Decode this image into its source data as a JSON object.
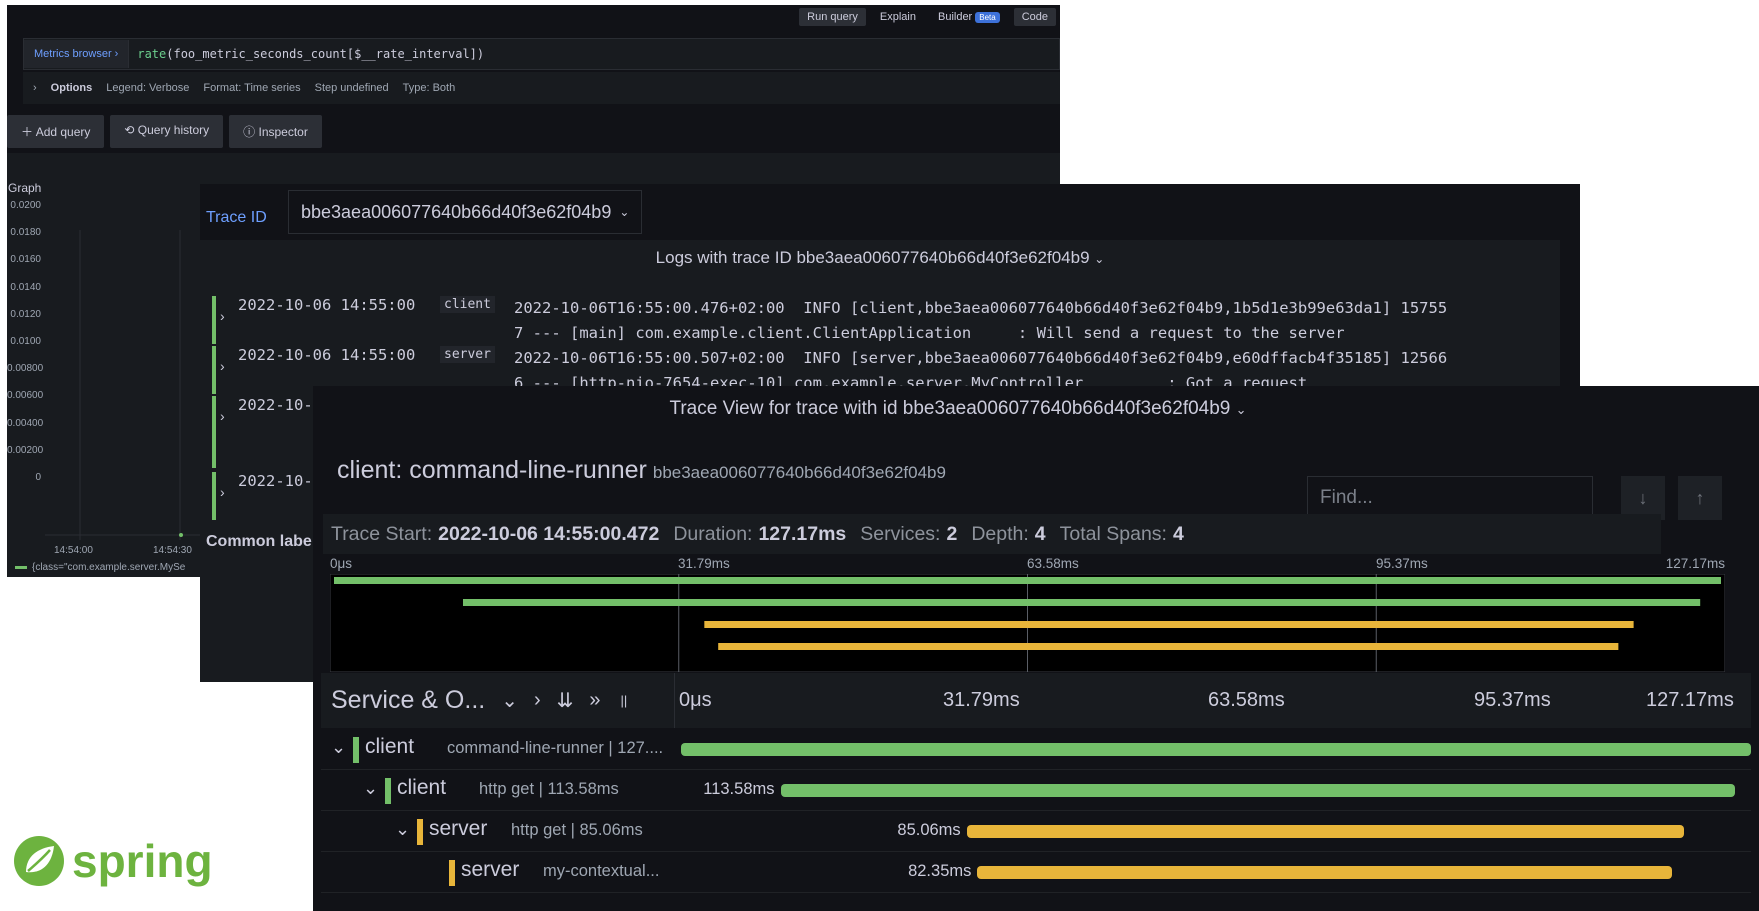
{
  "explore": {
    "toolbar": {
      "run_query": "Run query",
      "explain": "Explain",
      "builder": "Builder",
      "beta": "Beta",
      "code": "Code"
    },
    "query": {
      "metrics_browser": "Metrics browser ›",
      "fn": "rate",
      "expr": "(foo_metric_seconds_count[$__rate_interval])"
    },
    "options": {
      "label": "Options",
      "legend": "Legend: Verbose",
      "format": "Format: Time series",
      "step": "Step undefined",
      "type": "Type: Both"
    },
    "actions": {
      "add_query": "Add query",
      "query_history": "Query history",
      "inspector": "Inspector"
    },
    "graph": {
      "title": "Graph",
      "yticks": [
        "0.0200",
        "0.0180",
        "0.0160",
        "0.0140",
        "0.0120",
        "0.0100",
        "0.00800",
        "0.00600",
        "0.00400",
        "0.00200",
        "0"
      ],
      "xticks": [
        "14:54:00",
        "14:54:30"
      ],
      "legend": "{class=\"com.example.server.MySe"
    }
  },
  "logs": {
    "trace_id_label": "Trace ID",
    "trace_id": "bbe3aea006077640b66d40f3e62f04b9",
    "title": "Logs with trace ID bbe3aea006077640b66d40f3e62f04b9",
    "rows": [
      {
        "ts": "2022-10-06 14:55:00",
        "svc": "client",
        "msg": "2022-10-06T16:55:00.476+02:00  INFO [client,bbe3aea006077640b66d40f3e62f04b9,1b5d1e3b99e63da1] 15755\n7 --- [main] com.example.client.ClientApplication     : Will send a request to the server"
      },
      {
        "ts": "2022-10-06 14:55:00",
        "svc": "server",
        "msg": "2022-10-06T16:55:00.507+02:00  INFO [server,bbe3aea006077640b66d40f3e62f04b9,e60dffacb4f35185] 12566\n6 --- [http-nio-7654-exec-10] com.example.server.MyController         : Got a request"
      },
      {
        "ts": "2022-10-",
        "svc": "",
        "msg": ""
      },
      {
        "ts": "2022-10-",
        "svc": "",
        "msg": ""
      }
    ],
    "common_labels": "Common labe"
  },
  "trace": {
    "title": "Trace View for trace with id bbe3aea006077640b66d40f3e62f04b9",
    "name": "client: command-line-runner",
    "trace_id": "bbe3aea006077640b66d40f3e62f04b9",
    "find_placeholder": "Find...",
    "summary": {
      "trace_start_label": "Trace Start:",
      "trace_start": "2022-10-06 14:55:00.472",
      "duration_label": "Duration:",
      "duration": "127.17ms",
      "services_label": "Services:",
      "services": "2",
      "depth_label": "Depth:",
      "depth": "4",
      "total_spans_label": "Total Spans:",
      "total_spans": "4"
    },
    "ticks": [
      "0μs",
      "31.79ms",
      "63.58ms",
      "95.37ms",
      "127.17ms"
    ],
    "service_header": "Service & O...",
    "colors": {
      "client": "#73bf69",
      "server": "#e8b53a"
    },
    "spans": [
      {
        "service": "client",
        "op": "command-line-runner | 127....",
        "start": 0.0,
        "end": 1.0,
        "duration": "",
        "depth": 0
      },
      {
        "service": "client",
        "op": "http get | 113.58ms",
        "start": 0.093,
        "end": 0.985,
        "duration": "113.58ms",
        "depth": 1
      },
      {
        "service": "server",
        "op": "http get | 85.06ms",
        "start": 0.267,
        "end": 0.937,
        "duration": "85.06ms",
        "depth": 2
      },
      {
        "service": "server",
        "op": "my-contextual...",
        "start": 0.277,
        "end": 0.926,
        "duration": "82.35ms",
        "depth": 3
      }
    ]
  },
  "logo": {
    "text": "spring"
  }
}
